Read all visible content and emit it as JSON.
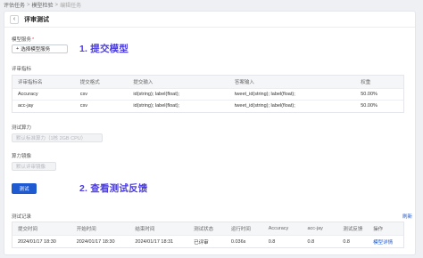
{
  "breadcrumb": {
    "items": [
      "评估任务",
      "模型检验",
      "编辑任务"
    ],
    "sep": ">"
  },
  "header": {
    "back_icon": "chevron-left-icon",
    "back_glyph": "‹",
    "title": "评审测试"
  },
  "model_service": {
    "label": "模型服务",
    "required_mark": "*",
    "button_icon": "plus-icon",
    "button_glyph": "+",
    "button_label": "选择模型服务"
  },
  "annotations": {
    "step1": "1. 提交模型",
    "step2": "2. 查看测试反馈",
    "color": "#4a3ce0"
  },
  "metrics": {
    "section_label": "评审指标",
    "columns": [
      "评审指标名",
      "提交格式",
      "提交输入",
      "答案输入",
      "权重"
    ],
    "rows": [
      [
        "Accuracy",
        "csv",
        "id(string); label(float);",
        "tweet_id(string); label(float);",
        "50.00%"
      ],
      [
        "acc-jay",
        "csv",
        "id(string); label(float);",
        "tweet_id(string); label(float);",
        "50.00%"
      ]
    ]
  },
  "compute": {
    "label": "测试算力",
    "value": "默认标准算力（1核 2GB CPU）"
  },
  "image": {
    "label": "算力镜像",
    "value": "默认评审镜像"
  },
  "test_button": {
    "label": "测试",
    "color": "#1f5ad1"
  },
  "records": {
    "section_label": "测试记录",
    "refresh_label": "刷新",
    "columns": [
      "提交时间",
      "开始时间",
      "结束时间",
      "测试状态",
      "运行时间",
      "Accuracy",
      "acc-jay",
      "测试反馈",
      "操作"
    ],
    "rows": [
      [
        "2024/01/17 18:30",
        "2024/01/17 18:30",
        "2024/01/17 18:31",
        "已评审",
        "0.036s",
        "0.8",
        "0.8",
        "0.8",
        "模型详情"
      ]
    ]
  }
}
